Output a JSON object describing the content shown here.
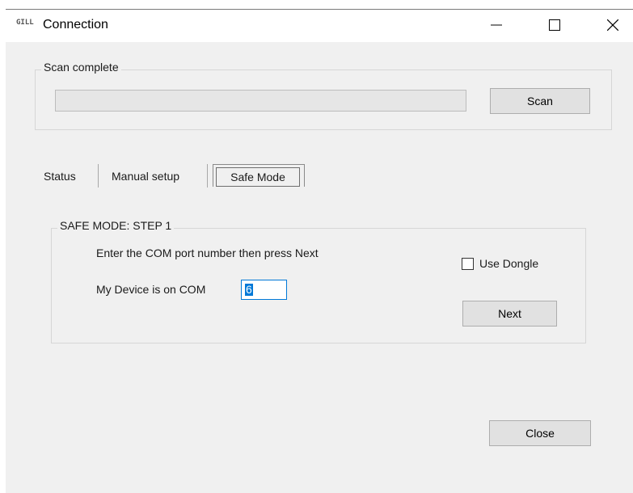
{
  "window": {
    "title": "Connection",
    "app_icon_text": "GILL",
    "controls": {
      "minimize": "minimize-icon",
      "maximize": "maximize-icon",
      "close": "close-icon"
    }
  },
  "scan": {
    "group_label": "Scan complete",
    "progress": 0,
    "scan_button": "Scan"
  },
  "tabs": [
    {
      "label": "Status",
      "active": false
    },
    {
      "label": "Manual setup",
      "active": false
    },
    {
      "label": "Safe Mode",
      "active": true
    }
  ],
  "safe_mode": {
    "group_label": "SAFE MODE: STEP 1",
    "instruction": "Enter the COM port number then press Next",
    "com_label": "My Device is on COM",
    "com_value": "6",
    "use_dongle_label": "Use Dongle",
    "use_dongle_checked": false,
    "next_button": "Next"
  },
  "footer": {
    "close_button": "Close"
  },
  "colors": {
    "window_bg": "#f0f0f0",
    "button_bg": "#e1e1e1",
    "focus_accent": "#0078d7"
  }
}
